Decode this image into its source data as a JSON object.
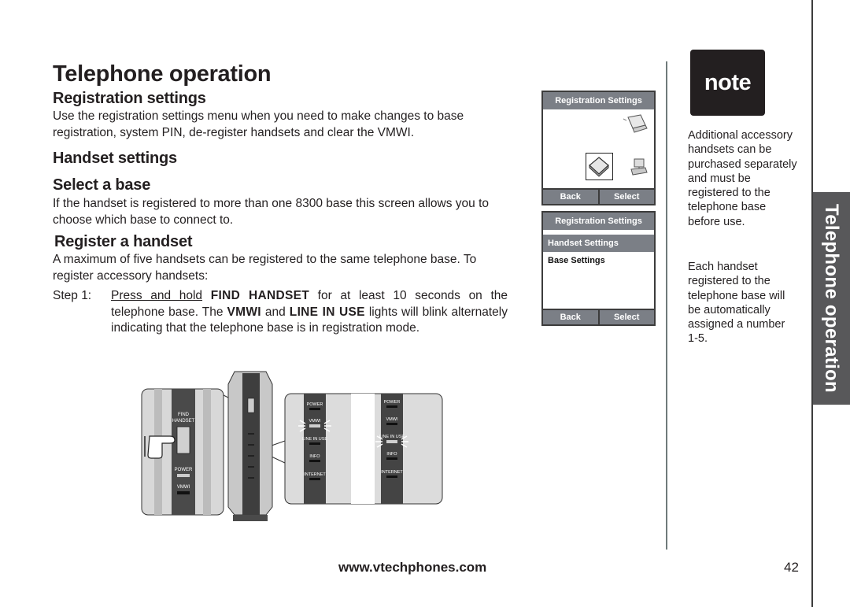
{
  "page": {
    "title": "Telephone operation",
    "side_tab": "Telephone operation",
    "footer_url": "www.vtechphones.com",
    "page_number": "42"
  },
  "sections": {
    "registration_settings": {
      "heading": "Registration settings",
      "body": "Use the registration settings menu when you need to make changes to base registration, system PIN, de-register handsets and clear the VMWI."
    },
    "handset_settings": {
      "heading": "Handset settings"
    },
    "select_base": {
      "heading": "Select a base",
      "body": "If the handset is registered to more than one 8300 base this screen allows you to choose which base to connect to."
    },
    "register_handset": {
      "heading": "Register a handset",
      "body": "A maximum of five handsets can be registered to the same telephone base. To register accessory handsets:",
      "step1": {
        "label": "Step 1:",
        "underlined": "Press and hold",
        "t1": " ",
        "b1": "FIND HANDSET",
        "t2": " for at least 10 seconds on the telephone base. The ",
        "b2": "VMWI",
        "t3": " and ",
        "b3": "LINE IN USE",
        "t4": " lights will blink alternately indicating that the telephone base is in registration mode."
      }
    }
  },
  "screens": [
    {
      "header": "Registration Settings",
      "icons": [
        "laptop-icon",
        "base-station-icon",
        "desktop-computer-icon"
      ],
      "selected_icon": "base-station-icon",
      "softkeys": [
        "Back",
        "Select"
      ]
    },
    {
      "header": "Registration Settings",
      "items": [
        {
          "label": "Handset Settings",
          "selected": true
        },
        {
          "label": "Base Settings",
          "selected": false
        }
      ],
      "softkeys": [
        "Back",
        "Select"
      ]
    }
  ],
  "note": {
    "badge": "note",
    "paragraphs": [
      "Additional accessory handsets can be purchased separately and must be registered to the telephone base before use.",
      "Each handset registered to the telephone base will be automatically assigned a number 1-5."
    ]
  },
  "illustration": {
    "base_labels": [
      "FIND HANDSET",
      "POWER",
      "VMWI",
      "LINE IN USE",
      "INFO",
      "INTERNET"
    ],
    "detail_left_labels": [
      "FIND",
      "HANDSET",
      "POWER",
      "VMWI"
    ],
    "blink_panels": [
      {
        "labels": [
          "POWER",
          "VMWI",
          "LINE IN USE",
          "INFO",
          "INTERNET"
        ],
        "lit": "VMWI"
      },
      {
        "labels": [
          "POWER",
          "VMWI",
          "LINE IN USE",
          "INFO",
          "INTERNET"
        ],
        "lit": "LINE IN USE"
      }
    ]
  }
}
